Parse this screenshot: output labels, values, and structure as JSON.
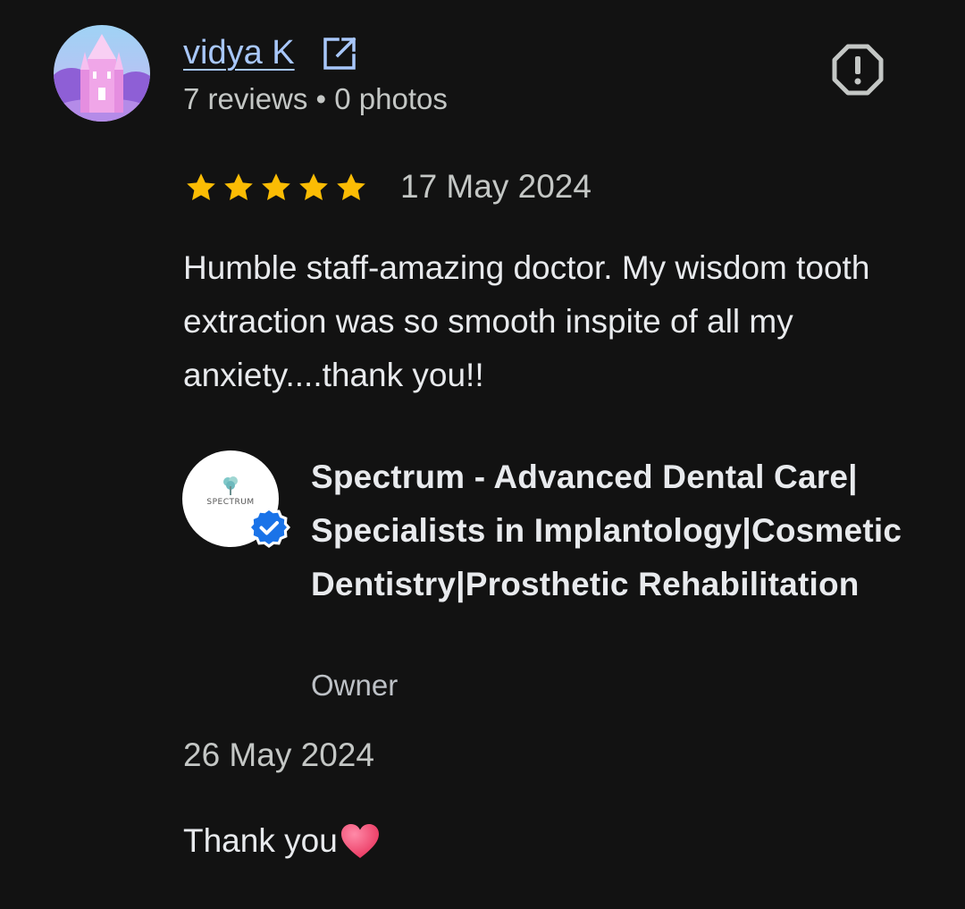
{
  "review": {
    "reviewer_name": "vidya K",
    "reviewer_meta": "7 reviews • 0 photos",
    "rating": 5,
    "rating_max": 5,
    "date": "17 May 2024",
    "text": "Humble staff-amazing doctor. My wisdom tooth extraction was so smooth inspite of all my anxiety....thank you!!"
  },
  "owner_reply": {
    "name": "Spectrum - Advanced Dental Care| Specialists in Implantology|Cosmetic Dentistry|Prosthetic Rehabilitation",
    "role": "Owner",
    "logo_text": "SPECTRUM",
    "date": "26 May 2024",
    "text": "Thank you"
  },
  "icons": {
    "open_profile": "open-in-new-icon",
    "report": "report-flag-icon",
    "star": "star-icon",
    "verified": "verified-badge-icon",
    "heart": "heart-emoji-icon"
  },
  "colors": {
    "background": "#121212",
    "link": "#a8c7fa",
    "star": "#fbbc04",
    "verified": "#1a73e8",
    "heart": "#f0456f"
  }
}
